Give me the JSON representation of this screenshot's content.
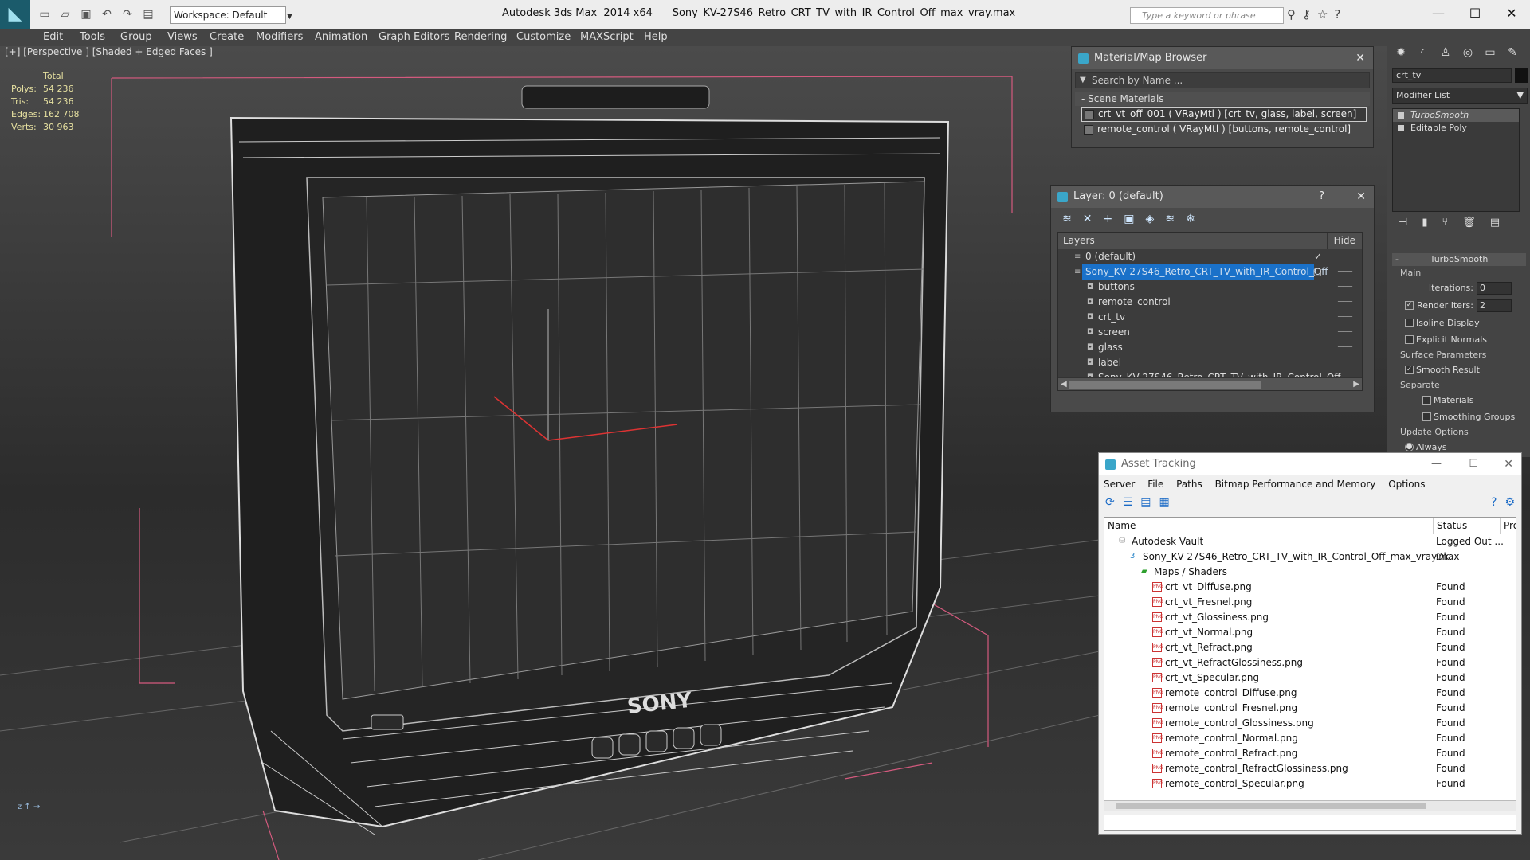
{
  "app": {
    "title": "Autodesk 3ds Max  2014 x64",
    "file": "Sony_KV-27S46_Retro_CRT_TV_with_IR_Control_Off_max_vray.max",
    "workspace": "Workspace: Default",
    "search_placeholder": "Type a keyword or phrase"
  },
  "menu": [
    "Edit",
    "Tools",
    "Group",
    "Views",
    "Create",
    "Modifiers",
    "Animation",
    "Graph Editors",
    "Rendering",
    "Customize",
    "MAXScript",
    "Help"
  ],
  "viewport": {
    "label": "[+] [Perspective ] [Shaded + Edged Faces ]",
    "stats": {
      "header": "Total",
      "rows": [
        {
          "label": "Polys:",
          "value": "54 236"
        },
        {
          "label": "Tris:",
          "value": "54 236"
        },
        {
          "label": "Edges:",
          "value": "162 708"
        },
        {
          "label": "Verts:",
          "value": "30 963"
        }
      ]
    },
    "brand": "SONY"
  },
  "material_browser": {
    "title": "Material/Map Browser",
    "search": "Search by Name ...",
    "section": "- Scene Materials",
    "materials": [
      "crt_vt_off_001  ( VRayMtl ) [crt_tv, glass, label, screen]",
      "remote_control  ( VRayMtl ) [buttons, remote_control]"
    ]
  },
  "layer_dialog": {
    "title": "Layer: 0 (default)",
    "help": "?",
    "col_layers": "Layers",
    "col_hide": "Hide",
    "layers": [
      {
        "name": "0 (default)",
        "indent": 0,
        "checked": true
      },
      {
        "name": "Sony_KV-27S46_Retro_CRT_TV_with_IR_Control_Off",
        "indent": 0,
        "selected": true
      },
      {
        "name": "buttons",
        "indent": 1
      },
      {
        "name": "remote_control",
        "indent": 1
      },
      {
        "name": "crt_tv",
        "indent": 1
      },
      {
        "name": "screen",
        "indent": 1
      },
      {
        "name": "glass",
        "indent": 1
      },
      {
        "name": "label",
        "indent": 1
      },
      {
        "name": "Sony_KV-27S46_Retro_CRT_TV_with_IR_Control_Off",
        "indent": 1
      }
    ]
  },
  "asset_tracking": {
    "title": "Asset Tracking",
    "menu": [
      "Server",
      "File",
      "Paths",
      "Bitmap Performance and Memory",
      "Options"
    ],
    "cols": {
      "name": "Name",
      "status": "Status",
      "prox": "Prox"
    },
    "rows": [
      {
        "name": "Autodesk Vault",
        "status": "Logged Out ...",
        "level": 0,
        "kind": "vault"
      },
      {
        "name": "Sony_KV-27S46_Retro_CRT_TV_with_IR_Control_Off_max_vray.max",
        "status": "Ok",
        "level": 1,
        "kind": "max"
      },
      {
        "name": "Maps / Shaders",
        "status": "",
        "level": 2,
        "kind": "folder"
      },
      {
        "name": "crt_vt_Diffuse.png",
        "status": "Found",
        "level": 3,
        "kind": "png"
      },
      {
        "name": "crt_vt_Fresnel.png",
        "status": "Found",
        "level": 3,
        "kind": "png"
      },
      {
        "name": "crt_vt_Glossiness.png",
        "status": "Found",
        "level": 3,
        "kind": "png"
      },
      {
        "name": "crt_vt_Normal.png",
        "status": "Found",
        "level": 3,
        "kind": "png"
      },
      {
        "name": "crt_vt_Refract.png",
        "status": "Found",
        "level": 3,
        "kind": "png"
      },
      {
        "name": "crt_vt_RefractGlossiness.png",
        "status": "Found",
        "level": 3,
        "kind": "png"
      },
      {
        "name": "crt_vt_Specular.png",
        "status": "Found",
        "level": 3,
        "kind": "png"
      },
      {
        "name": "remote_control_Diffuse.png",
        "status": "Found",
        "level": 3,
        "kind": "png"
      },
      {
        "name": "remote_control_Fresnel.png",
        "status": "Found",
        "level": 3,
        "kind": "png"
      },
      {
        "name": "remote_control_Glossiness.png",
        "status": "Found",
        "level": 3,
        "kind": "png"
      },
      {
        "name": "remote_control_Normal.png",
        "status": "Found",
        "level": 3,
        "kind": "png"
      },
      {
        "name": "remote_control_Refract.png",
        "status": "Found",
        "level": 3,
        "kind": "png"
      },
      {
        "name": "remote_control_RefractGlossiness.png",
        "status": "Found",
        "level": 3,
        "kind": "png"
      },
      {
        "name": "remote_control_Specular.png",
        "status": "Found",
        "level": 3,
        "kind": "png"
      }
    ]
  },
  "command_panel": {
    "object_name": "crt_tv",
    "modifier_list": "Modifier List",
    "stack": [
      {
        "name": "TurboSmooth",
        "selected": true
      },
      {
        "name": "Editable Poly",
        "selected": false
      }
    ],
    "rollout": "TurboSmooth",
    "main": "Main",
    "iterations_label": "Iterations:",
    "iterations": "0",
    "render_iters_label": "Render Iters:",
    "render_iters": "2",
    "isoline": "Isoline Display",
    "explicit": "Explicit Normals",
    "surface": "Surface Parameters",
    "smooth_result": "Smooth Result",
    "separate": "Separate",
    "materials": "Materials",
    "smoothing_groups": "Smoothing Groups",
    "update": "Update Options",
    "always": "Always"
  },
  "colors": {
    "selection": "#1a71c9",
    "stats": "#e6e0a0",
    "accent": "#3aa6c9"
  }
}
